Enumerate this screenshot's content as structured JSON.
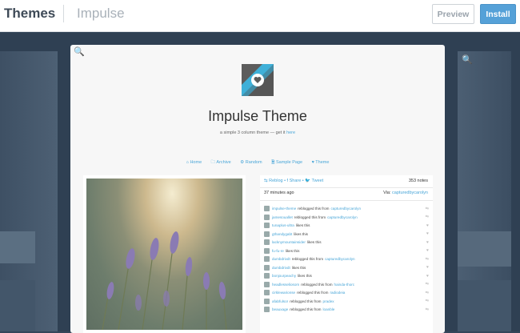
{
  "header": {
    "brand": "Themes",
    "theme_name": "Impulse",
    "preview_label": "Preview",
    "install_label": "Install"
  },
  "preview": {
    "title": "Impulse Theme",
    "subtitle_prefix": "a simple 3 column theme — get it ",
    "subtitle_link": "here",
    "nav": [
      "⌂ Home",
      "🗀 Archive",
      "⚙ Random",
      "🗎 Sample Page",
      "♥ Theme"
    ],
    "notes": {
      "actions": "⇆ Reblog • f Share • 🐦 Tweet",
      "count": "353 notes",
      "time": "37 minutes ago",
      "via_label": "Via:",
      "via_user": "capturedbycarolyn",
      "rows": [
        {
          "user": "impulse-theme",
          "text": "reblogged this from",
          "src": "capturedbycarolyn",
          "icon": "⇆"
        },
        {
          "user": "jamesouallet",
          "text": "reblogged this from",
          "src": "capturedbycarolyn",
          "icon": "⇆"
        },
        {
          "user": "tunaplus-ultra",
          "text": "likes this",
          "src": "",
          "icon": "♥"
        },
        {
          "user": "gthandygabt",
          "text": "likes this",
          "src": "",
          "icon": "♥"
        },
        {
          "user": "lacknymountainsider",
          "text": "likes this",
          "src": "",
          "icon": "♥"
        },
        {
          "user": "fu-fu-re",
          "text": "likes this",
          "src": "",
          "icon": "♥"
        },
        {
          "user": "dumbdrivdt",
          "text": "reblogged this from",
          "src": "capturedbycarolyn",
          "icon": "⇆"
        },
        {
          "user": "dumbdrivdt",
          "text": "likes this",
          "src": "",
          "icon": "♥"
        },
        {
          "user": "bonjourpeachy",
          "text": "likes this",
          "src": "",
          "icon": "♥"
        },
        {
          "user": "headlesseliosom",
          "text": "reblogged this from",
          "src": "hainda-thorc",
          "icon": "⇆"
        },
        {
          "user": "cirklewarionse",
          "text": "reblogged this from",
          "src": "radiodeia",
          "icon": "⇆"
        },
        {
          "user": "afabfulsor",
          "text": "reblogged this from",
          "src": "pradex",
          "icon": "⇆"
        },
        {
          "user": "beauxage",
          "text": "reblogged this from",
          "src": "loanble",
          "icon": "⇆"
        }
      ]
    }
  },
  "colors": {
    "accent": "#55a1d8",
    "link": "#49a6d8",
    "stage": "#2f4053"
  }
}
